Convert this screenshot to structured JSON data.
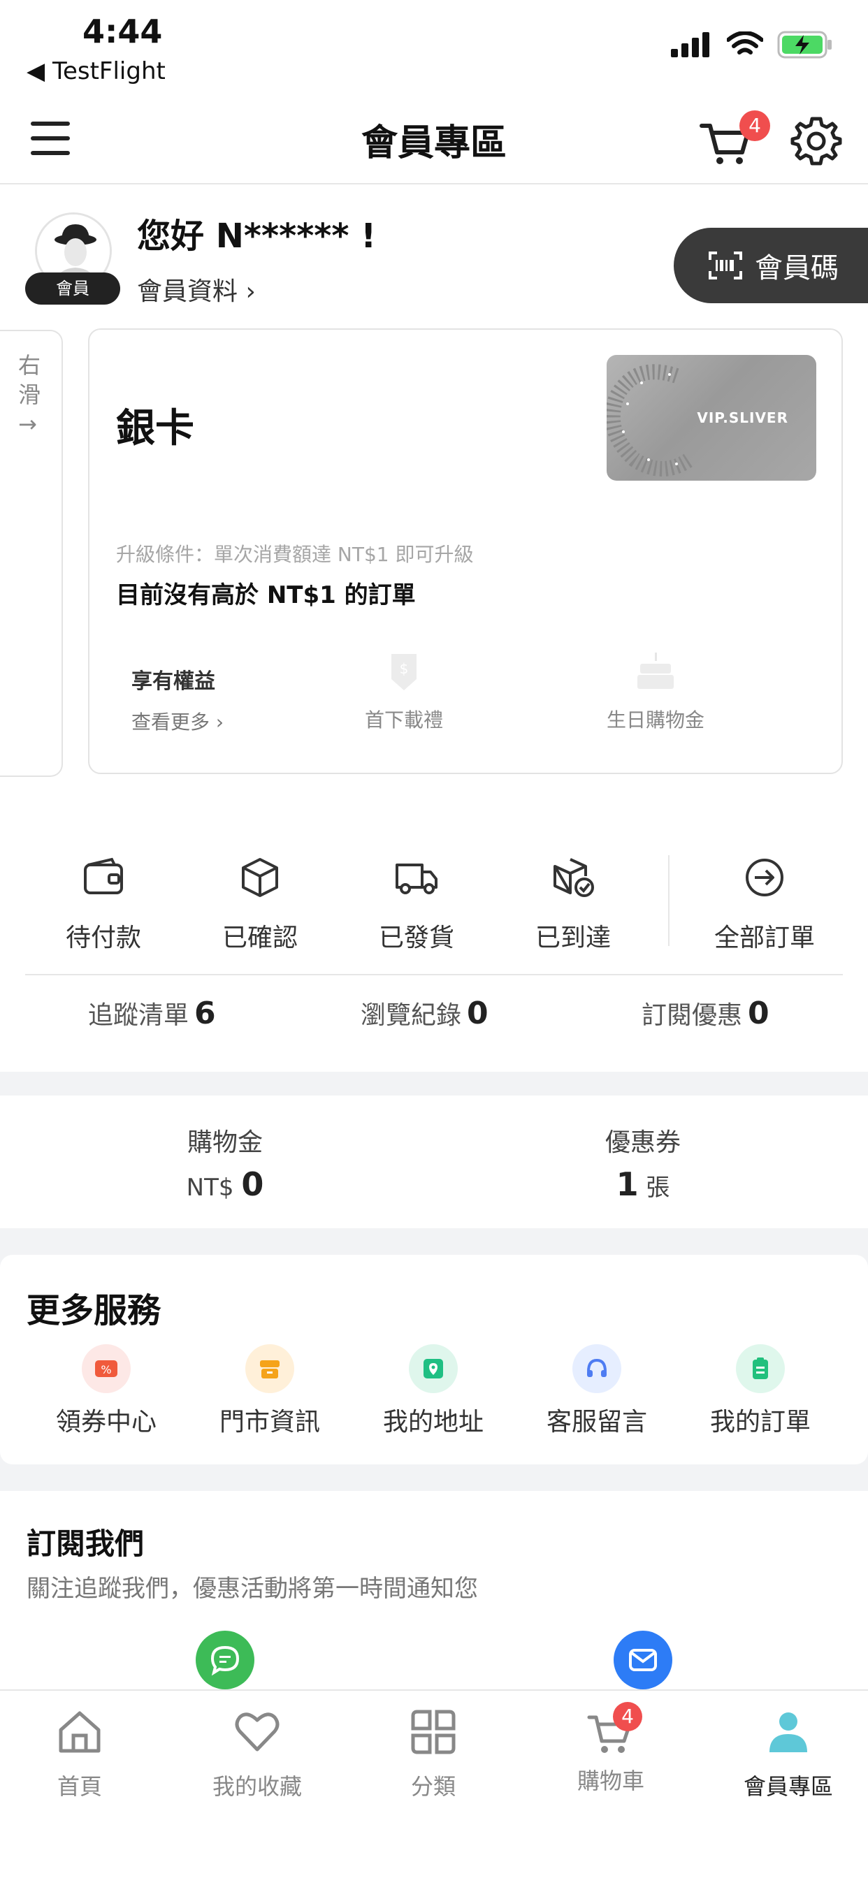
{
  "status": {
    "time": "4:44",
    "back_app": "◀ TestFlight"
  },
  "header": {
    "title": "會員專區",
    "cart_count": "4"
  },
  "profile": {
    "greeting": "您好 N****** !",
    "avatar_tag": "會員",
    "member_info": "會員資料 ›",
    "member_code": "會員碼",
    "side_hint": "右滑→"
  },
  "card": {
    "tier": "銀卡",
    "vip_label": "VIP.SLIVER",
    "upgrade_condition": "升級條件：單次消費額達 NT$1 即可升級",
    "order_note": "目前沒有高於 NT$1 的訂單",
    "benefits_title": "享有權益",
    "benefits_more": "查看更多 ›",
    "benefit_1": "首下載禮",
    "benefit_2": "生日購物金"
  },
  "orders": {
    "items": [
      {
        "label": "待付款"
      },
      {
        "label": "已確認"
      },
      {
        "label": "已發貨"
      },
      {
        "label": "已到達"
      }
    ],
    "all": "全部訂單"
  },
  "stats": [
    {
      "label": "追蹤清單",
      "value": "6"
    },
    {
      "label": "瀏覽紀錄",
      "value": "0"
    },
    {
      "label": "訂閱優惠",
      "value": "0"
    }
  ],
  "wallet": {
    "points_label": "購物金",
    "points_prefix": "NT$",
    "points_value": "0",
    "coupon_label": "優惠券",
    "coupon_value": "1",
    "coupon_unit": "張"
  },
  "services": {
    "title": "更多服務",
    "items": [
      {
        "label": "領券中心"
      },
      {
        "label": "門市資訊"
      },
      {
        "label": "我的地址"
      },
      {
        "label": "客服留言"
      },
      {
        "label": "我的訂單"
      }
    ]
  },
  "subscribe": {
    "title": "訂閱我們",
    "desc": "關注追蹤我們，優惠活動將第一時間通知您"
  },
  "tabbar": {
    "home": "首頁",
    "favorites": "我的收藏",
    "category": "分類",
    "cart": "購物車",
    "cart_count": "4",
    "member": "會員專區"
  },
  "colors": {
    "badge": "#f04e4e",
    "accent_teal": "#5ec8d8",
    "line_green": "#3dbb57",
    "mail_blue": "#2d7cf6"
  }
}
